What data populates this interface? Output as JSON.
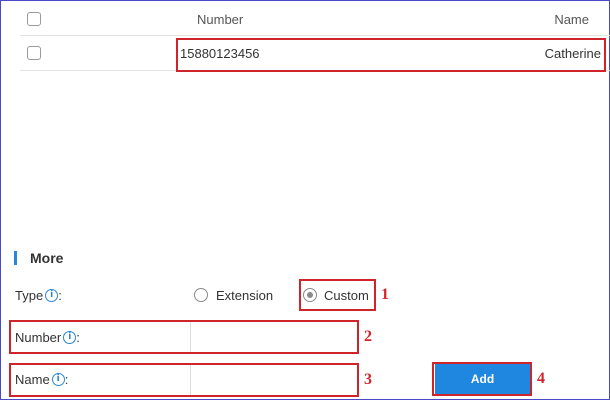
{
  "table": {
    "headers": {
      "number": "Number",
      "name": "Name"
    },
    "rows": [
      {
        "number": "15880123456",
        "name": "Catherine"
      }
    ]
  },
  "more": {
    "title": "More",
    "type": {
      "label": "Type",
      "suffix": ":",
      "options": [
        {
          "label": "Extension",
          "selected": false
        },
        {
          "label": "Custom",
          "selected": true
        }
      ]
    },
    "number": {
      "label": "Number",
      "suffix": ":",
      "value": ""
    },
    "name": {
      "label": "Name",
      "suffix": ":",
      "value": ""
    },
    "add_label": "Add"
  },
  "annotations": [
    "1",
    "2",
    "3",
    "4"
  ],
  "colors": {
    "accent": "#1f87e0",
    "annotation": "#d0242c",
    "section_bar": "#2a86d6"
  },
  "icons": {
    "info": "info-icon"
  }
}
